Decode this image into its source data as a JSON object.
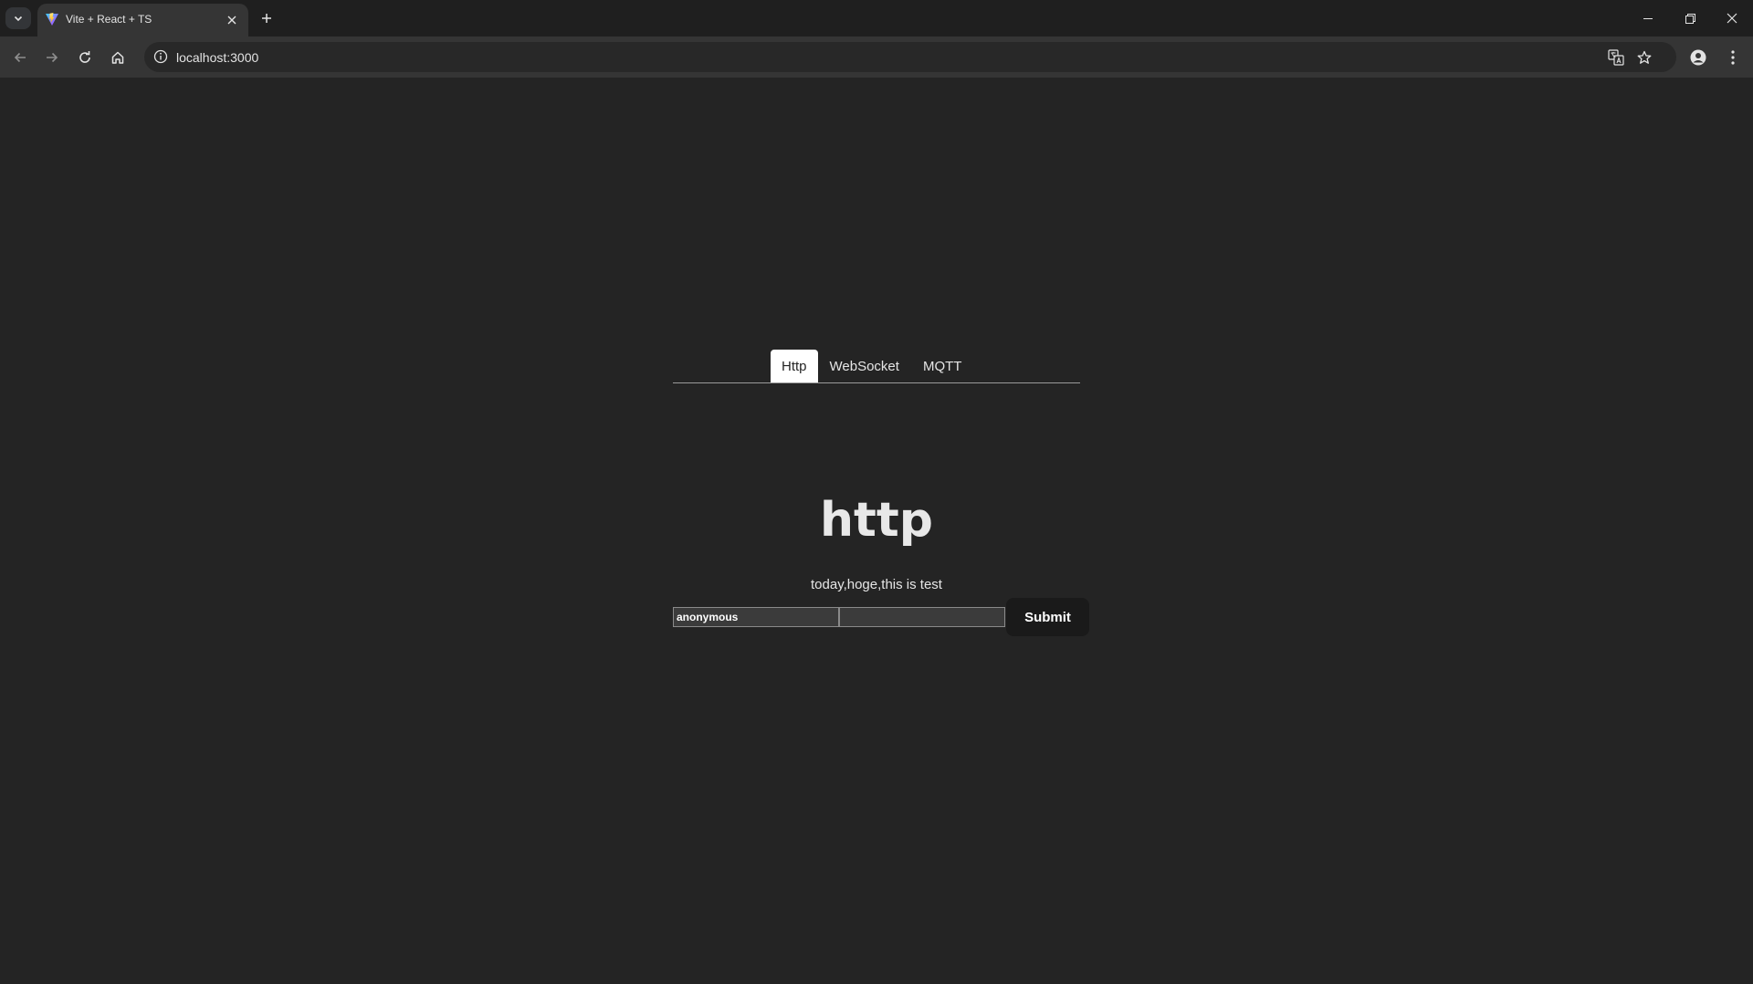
{
  "browser": {
    "tab_title": "Vite + React + TS",
    "url": "localhost:3000"
  },
  "app": {
    "tabs": [
      {
        "label": "Http",
        "active": true
      },
      {
        "label": "WebSocket",
        "active": false
      },
      {
        "label": "MQTT",
        "active": false
      }
    ],
    "heading": "http",
    "message": "today,hoge,this is test",
    "form": {
      "name_value": "anonymous",
      "text_value": "",
      "submit_label": "Submit"
    }
  },
  "colors": {
    "page_background": "#242424",
    "active_tab_background": "#ffffff",
    "submit_background": "#1a1a1a"
  }
}
